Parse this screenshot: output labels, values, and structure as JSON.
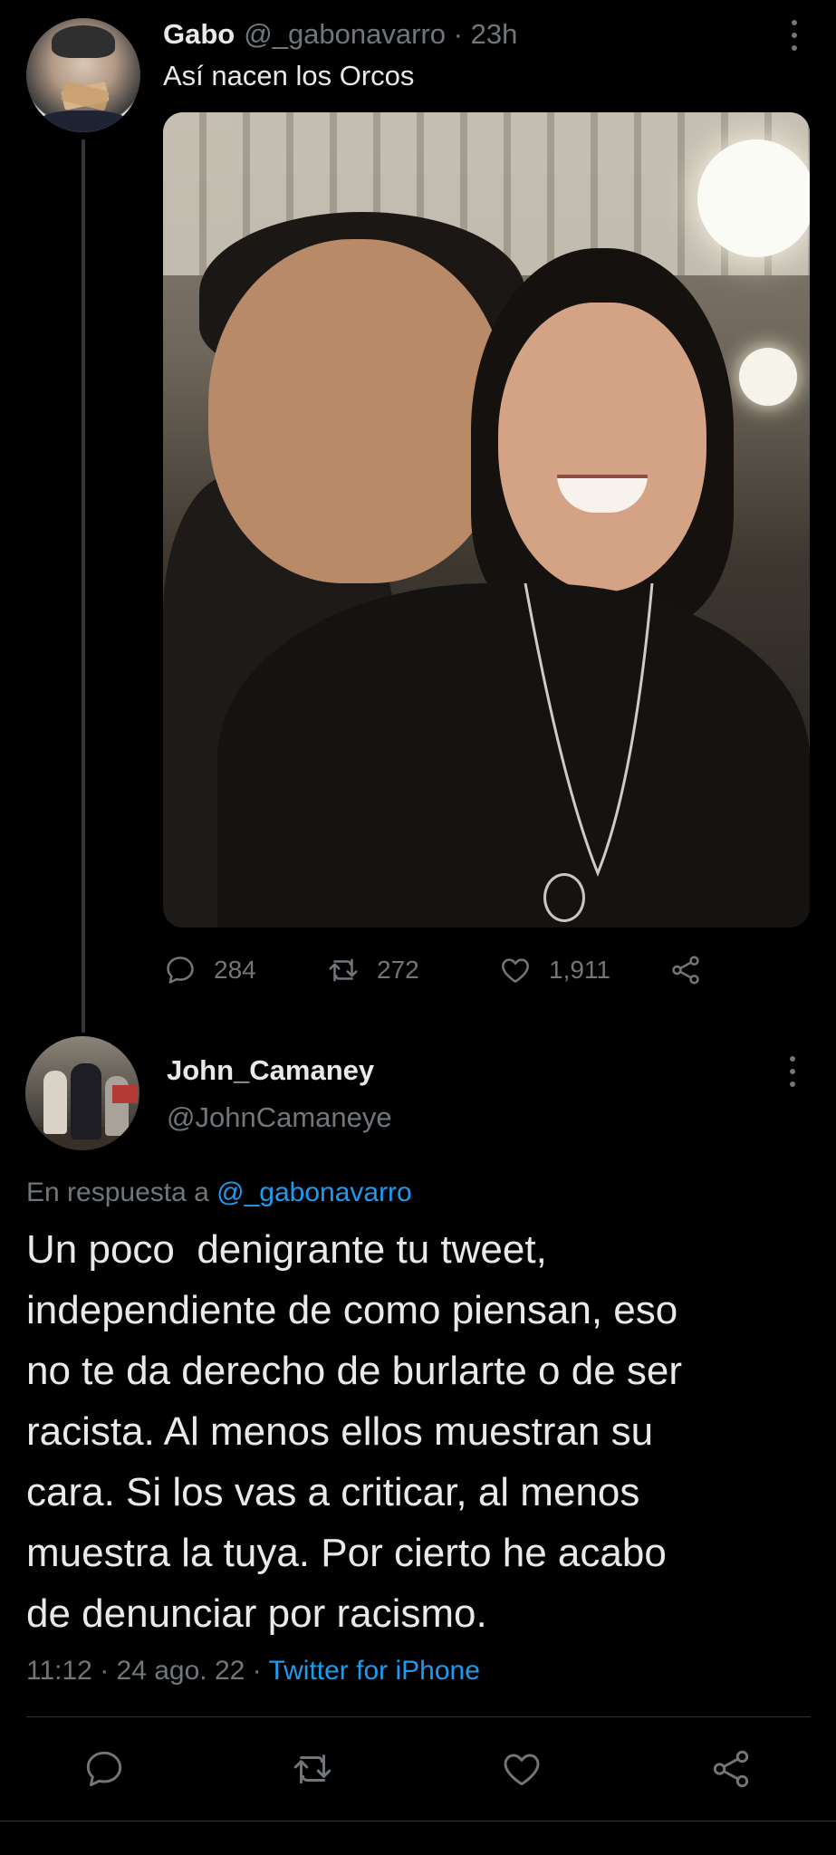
{
  "tweet": {
    "author_name": "Gabo",
    "author_handle": "@_gabonavarro",
    "time": "23h",
    "text": "Así nacen los Orcos",
    "stats": {
      "replies": "284",
      "retweets": "272",
      "likes": "1,911"
    }
  },
  "reply": {
    "author_name": "John_Camaney",
    "author_handle": "@JohnCamaneye",
    "in_reply_label": "En respuesta a",
    "in_reply_mention": "@_gabonavarro",
    "text": "Un poco  denigrante tu tweet,\nindependiente de como piensan, eso\nno te da derecho de burlarte o de ser\nracista. Al menos ellos muestran su\ncara. Si los vas a criticar, al menos\nmuestra la tuya. Por cierto he acabo\nde denunciar por racismo.",
    "time": "11:12",
    "date": "24 ago. 22",
    "source": "Twitter for iPhone"
  },
  "icons": {
    "reply": "reply-bubble-icon",
    "retweet": "retweet-icon",
    "like": "heart-icon",
    "share": "share-icon",
    "more": "more-dots-icon"
  },
  "colors": {
    "background": "#000000",
    "text": "#e7e9ea",
    "secondary": "#71767b",
    "link": "#1d9bf0",
    "divider": "#2f3336"
  }
}
